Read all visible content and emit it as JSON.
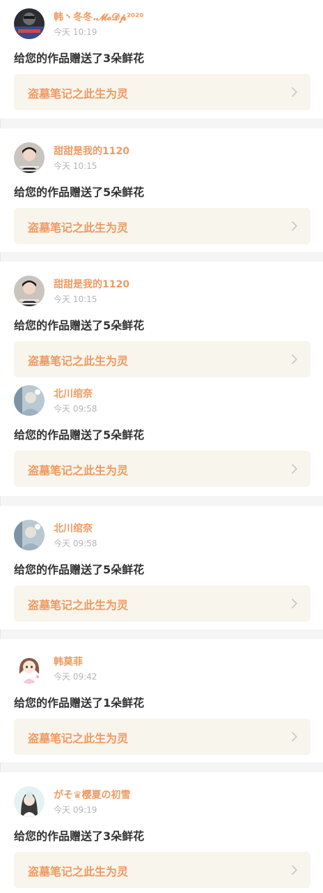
{
  "colors": {
    "accent": "#f09a62",
    "link_bg": "#f7f5ec",
    "text_primary": "#333333",
    "text_secondary": "#b5b5b5",
    "separator": "#f5f5f5"
  },
  "notifications": [
    {
      "user": "韩丶冬冬.𝓜𝓸𝓓𝓹²⁰²⁰",
      "time": "今天 10:19",
      "message": "给您的作品赠送了3朵鲜花",
      "work_title": "盗墓笔记之此生为灵",
      "avatar_icon": "avatar-dark-photo-icon"
    },
    {
      "user": "甜甜是我的1120",
      "time": "今天 10:15",
      "message": "给您的作品赠送了5朵鲜花",
      "work_title": "盗墓笔记之此生为灵",
      "avatar_icon": "avatar-boy-stripes-icon"
    },
    {
      "user": "甜甜是我的1120",
      "time": "今天 10:15",
      "message": "给您的作品赠送了5朵鲜花",
      "work_title": "盗墓笔记之此生为灵",
      "avatar_icon": "avatar-boy-stripes-icon"
    },
    {
      "user": "北川绾奈",
      "time": "今天 09:58",
      "message": "给您的作品赠送了5朵鲜花",
      "work_title": "盗墓笔记之此生为灵",
      "avatar_icon": "avatar-blue-photo-icon"
    },
    {
      "user": "北川绾奈",
      "time": "今天 09:58",
      "message": "给您的作品赠送了5朵鲜花",
      "work_title": "盗墓笔记之此生为灵",
      "avatar_icon": "avatar-blue-photo-icon"
    },
    {
      "user": "韩莫菲",
      "time": "今天 09:42",
      "message": "给您的作品赠送了1朵鲜花",
      "work_title": "盗墓笔记之此生为灵",
      "avatar_icon": "avatar-anime-girl-icon"
    },
    {
      "user": "がそ♛樱夏の初雪",
      "time": "今天 09:19",
      "message": "给您的作品赠送了3朵鲜花",
      "work_title": "盗墓笔记之此生为灵",
      "avatar_icon": "avatar-girl-photo-icon"
    }
  ]
}
